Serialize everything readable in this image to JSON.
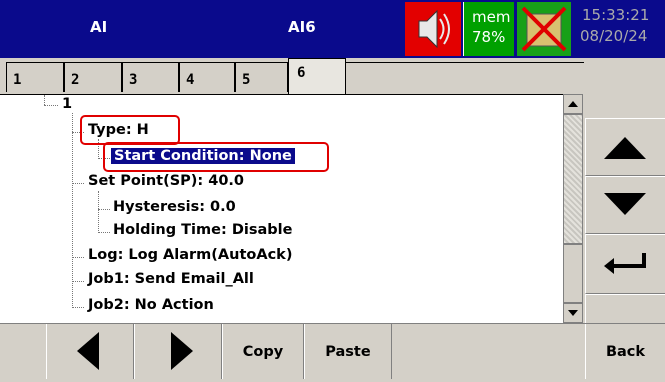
{
  "header": {
    "title_left": "AI",
    "title_right": "AI6",
    "mem_label": "mem",
    "mem_value": "78%",
    "time": "15:33:21",
    "date": "08/20/24",
    "speaker_icon": "speaker-icon",
    "disabled_icon": "crossed-out-icon"
  },
  "tabs": [
    {
      "label": "1"
    },
    {
      "label": "2"
    },
    {
      "label": "3"
    },
    {
      "label": "4"
    },
    {
      "label": "5"
    },
    {
      "label": "6"
    }
  ],
  "active_tab": "6",
  "tree": {
    "root": "1",
    "type": "Type: H",
    "start_condition": "Start Condition: None",
    "set_point": "Set Point(SP): 40.0",
    "hysteresis": "Hysteresis: 0.0",
    "holding_time": "Holding Time: Disable",
    "log": "Log: Log Alarm(AutoAck)",
    "job1": "Job1: Send Email_All",
    "job2": "Job2: No Action"
  },
  "side_buttons": {
    "up": "triangle-up-icon",
    "down": "triangle-down-icon",
    "enter": "enter-arrow-icon"
  },
  "bottom": {
    "prev": "left-triangle-icon",
    "next": "right-triangle-icon",
    "copy": "Copy",
    "paste": "Paste",
    "back": "Back"
  },
  "colors": {
    "header_bg": "#0a0a8c",
    "selected_bg": "#0a0a8c",
    "highlight_border": "#e00000",
    "mem_bg": "#00a000",
    "speaker_bg": "#e30000"
  }
}
